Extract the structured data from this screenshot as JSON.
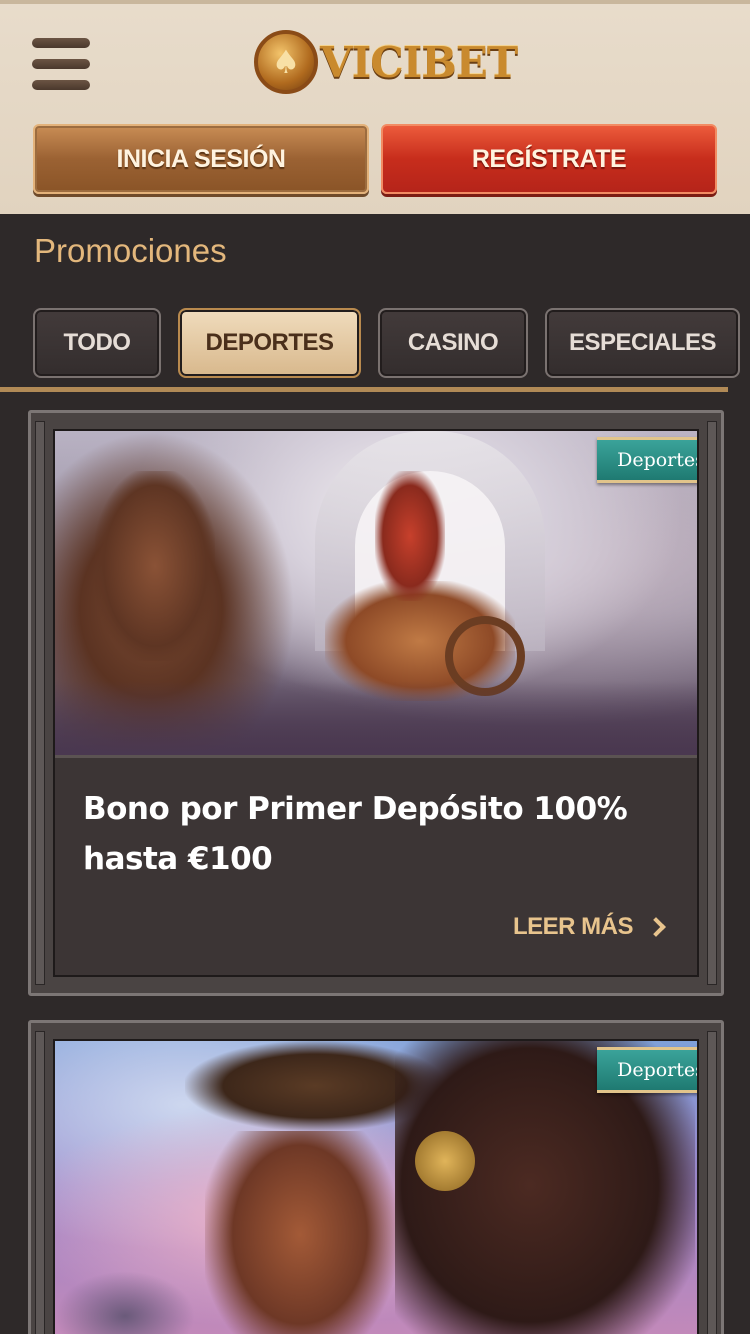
{
  "header": {
    "logo_text": "VICIBET",
    "logo_icon": "spade-icon",
    "login_label": "INICIA SESIÓN",
    "register_label": "REGÍSTRATE"
  },
  "section_title": "Promociones",
  "tabs": [
    {
      "label": "TODO",
      "active": false
    },
    {
      "label": "DEPORTES",
      "active": true
    },
    {
      "label": "CASINO",
      "active": false
    },
    {
      "label": "ESPECIALES",
      "active": false
    }
  ],
  "promos": [
    {
      "badge": "Deportes",
      "title_line1": "Bono por Primer Depósito 100%",
      "title_line2": "hasta €100",
      "read_more": "LEER MÁS"
    },
    {
      "badge": "Deportes"
    }
  ],
  "colors": {
    "background": "#2e2929",
    "header": "#e1d3bf",
    "accent_gold": "#e3b77c",
    "register_red": "#c72d1c",
    "badge_teal": "#1f7a72"
  }
}
